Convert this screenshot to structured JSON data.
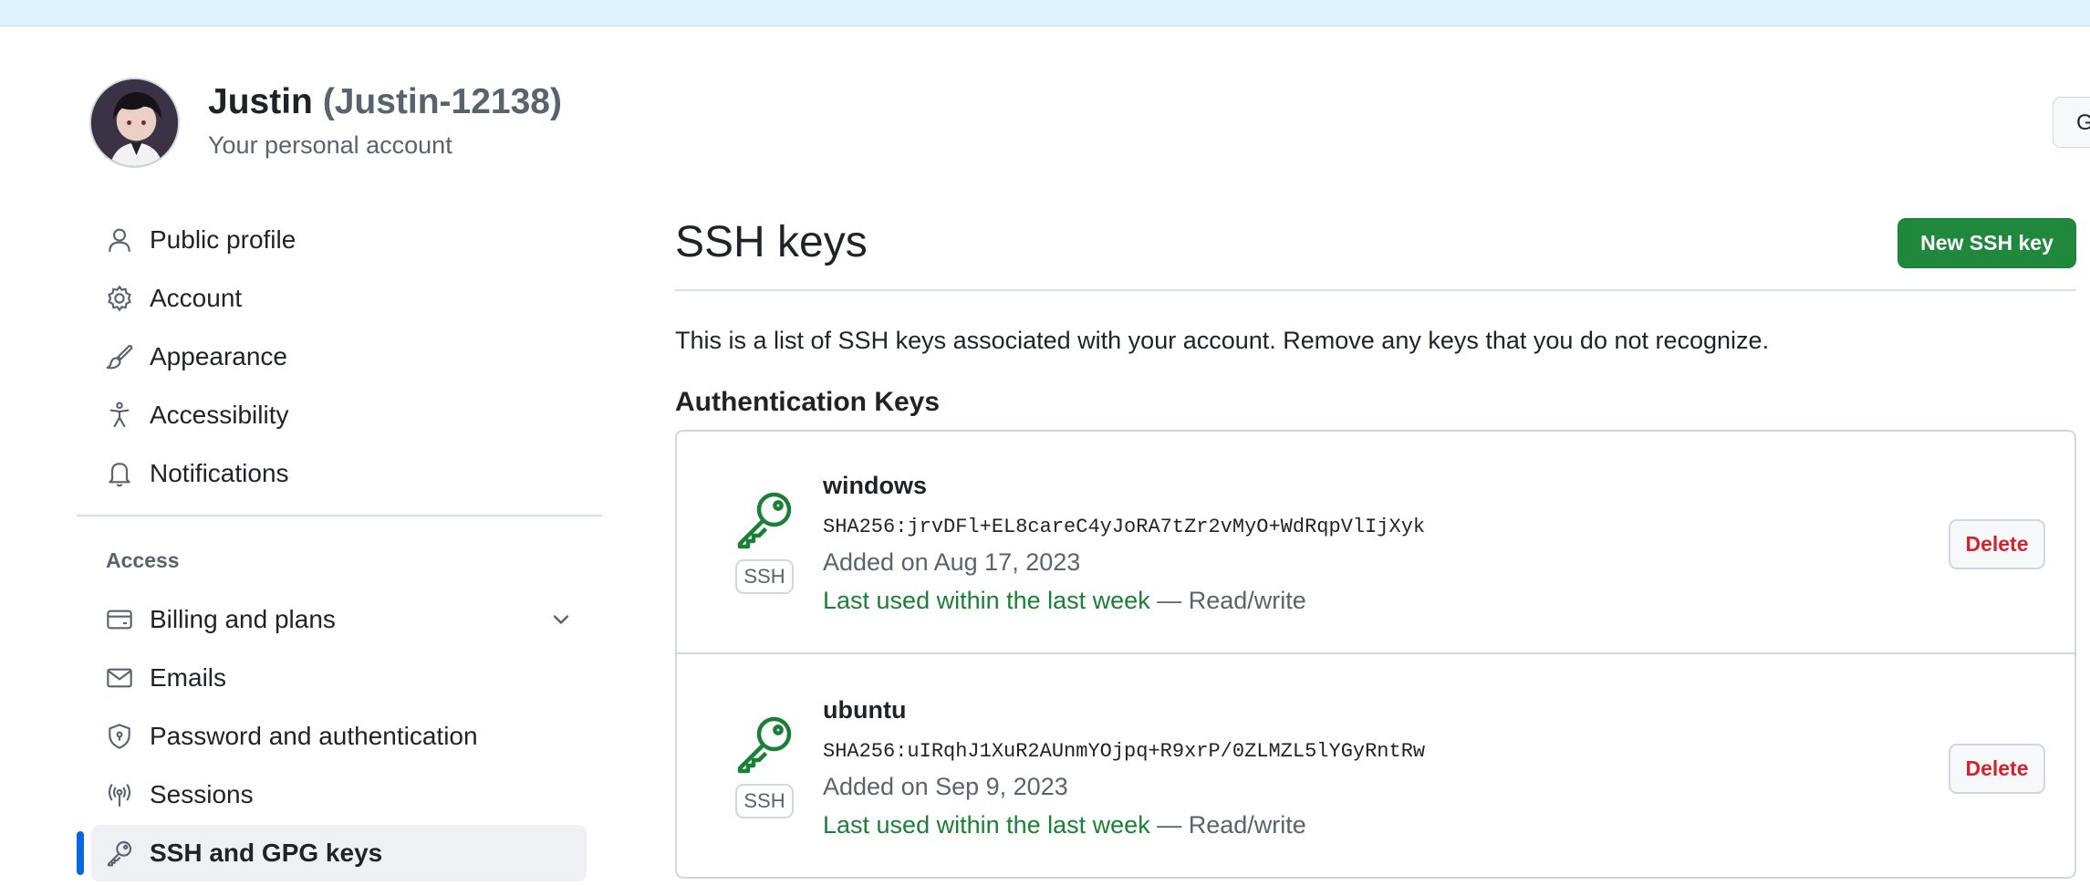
{
  "header": {
    "name": "Justin",
    "login": "(Justin-12138)",
    "subtitle": "Your personal account",
    "goto_button": "Go to your personal profile"
  },
  "sidebar": {
    "items": [
      {
        "label": "Public profile",
        "icon": "person-icon"
      },
      {
        "label": "Account",
        "icon": "gear-icon"
      },
      {
        "label": "Appearance",
        "icon": "paintbrush-icon"
      },
      {
        "label": "Accessibility",
        "icon": "accessibility-icon"
      },
      {
        "label": "Notifications",
        "icon": "bell-icon"
      }
    ],
    "access_heading": "Access",
    "access_items": [
      {
        "label": "Billing and plans",
        "icon": "credit-card-icon"
      },
      {
        "label": "Emails",
        "icon": "mail-icon"
      },
      {
        "label": "Password and authentication",
        "icon": "shield-lock-icon"
      },
      {
        "label": "Sessions",
        "icon": "broadcast-icon"
      },
      {
        "label": "SSH and GPG keys",
        "icon": "key-icon",
        "active": true
      }
    ]
  },
  "main": {
    "title": "SSH keys",
    "new_key_button": "New SSH key",
    "intro": "This is a list of SSH keys associated with your account. Remove any keys that you do not recognize.",
    "section_heading": "Authentication Keys",
    "keys": [
      {
        "name": "windows",
        "type": "SSH",
        "fingerprint": "SHA256:jrvDFl+EL8careC4yJoRA7tZr2vMyO+WdRqpVlIjXyk",
        "added": "Added on Aug 17, 2023",
        "last_used": "Last used within the last week",
        "separator": "—",
        "access": "Read/write",
        "delete_label": "Delete"
      },
      {
        "name": "ubuntu",
        "type": "SSH",
        "fingerprint": "SHA256:uIRqhJ1XuR2AUnmYOjpq+R9xrP/0ZLMZL5lYGyRntRw",
        "added": "Added on Sep 9, 2023",
        "last_used": "Last used within the last week",
        "separator": "—",
        "access": "Read/write",
        "delete_label": "Delete"
      }
    ]
  },
  "colors": {
    "accent_green": "#1f883d",
    "usage_green": "#1a7f37",
    "danger_red": "#d1242f",
    "active_indicator": "#0969da",
    "topbar": "#ddf4ff"
  }
}
